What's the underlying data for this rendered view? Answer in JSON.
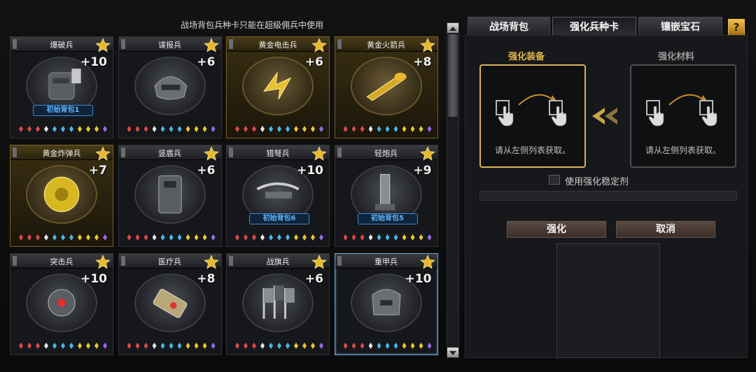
{
  "notice": "战场背包兵种卡只能在超級佣兵中使用",
  "colors": {
    "gold": "#e8b82e",
    "badge_blue": "#5fb4ff",
    "highlight": "#d8b354",
    "selected": "#6ea6d6"
  },
  "cards": [
    {
      "name": "爆破兵",
      "level": "+10",
      "badge": "初始背包1",
      "style": "normal",
      "icon": "backpack-icon"
    },
    {
      "name": "谍报兵",
      "level": "+6",
      "badge": "",
      "style": "normal",
      "icon": "helmet-icon"
    },
    {
      "name": "黄金电击兵",
      "level": "+6",
      "badge": "",
      "style": "gold",
      "icon": "lightning-glove-icon"
    },
    {
      "name": "黄金火箭兵",
      "level": "+8",
      "badge": "",
      "style": "gold",
      "icon": "rocket-launcher-icon"
    },
    {
      "name": "黄金炸弹兵",
      "level": "+7",
      "badge": "",
      "style": "gold",
      "icon": "bomb-icon"
    },
    {
      "name": "竖盾兵",
      "level": "+6",
      "badge": "",
      "style": "normal",
      "icon": "riot-shield-icon"
    },
    {
      "name": "猎弩兵",
      "level": "+10",
      "badge": "初始背包6",
      "style": "normal",
      "icon": "crossbow-icon"
    },
    {
      "name": "轻炮兵",
      "level": "+9",
      "badge": "初始背包5",
      "style": "normal",
      "icon": "mortar-icon"
    },
    {
      "name": "突击兵",
      "level": "+10",
      "badge": "",
      "style": "normal",
      "icon": "scope-icon"
    },
    {
      "name": "医疗兵",
      "level": "+8",
      "badge": "",
      "style": "normal",
      "icon": "medkit-icon"
    },
    {
      "name": "战旗兵",
      "level": "+6",
      "badge": "",
      "style": "normal",
      "icon": "flags-icon"
    },
    {
      "name": "重甲兵",
      "level": "+10",
      "badge": "",
      "style": "selected",
      "icon": "armor-icon"
    }
  ],
  "tabs": [
    {
      "label": "战场背包",
      "active": false
    },
    {
      "label": "强化兵种卡",
      "active": true
    },
    {
      "label": "镶嵌宝石",
      "active": false
    }
  ],
  "help_label": "?",
  "equipment_label": "强化装备",
  "material_label": "强化材料",
  "slot_hint": "请从左侧列表获取。",
  "stabilizer_label": "使用强化稳定剂",
  "enhance_button": "强化",
  "cancel_button": "取消"
}
